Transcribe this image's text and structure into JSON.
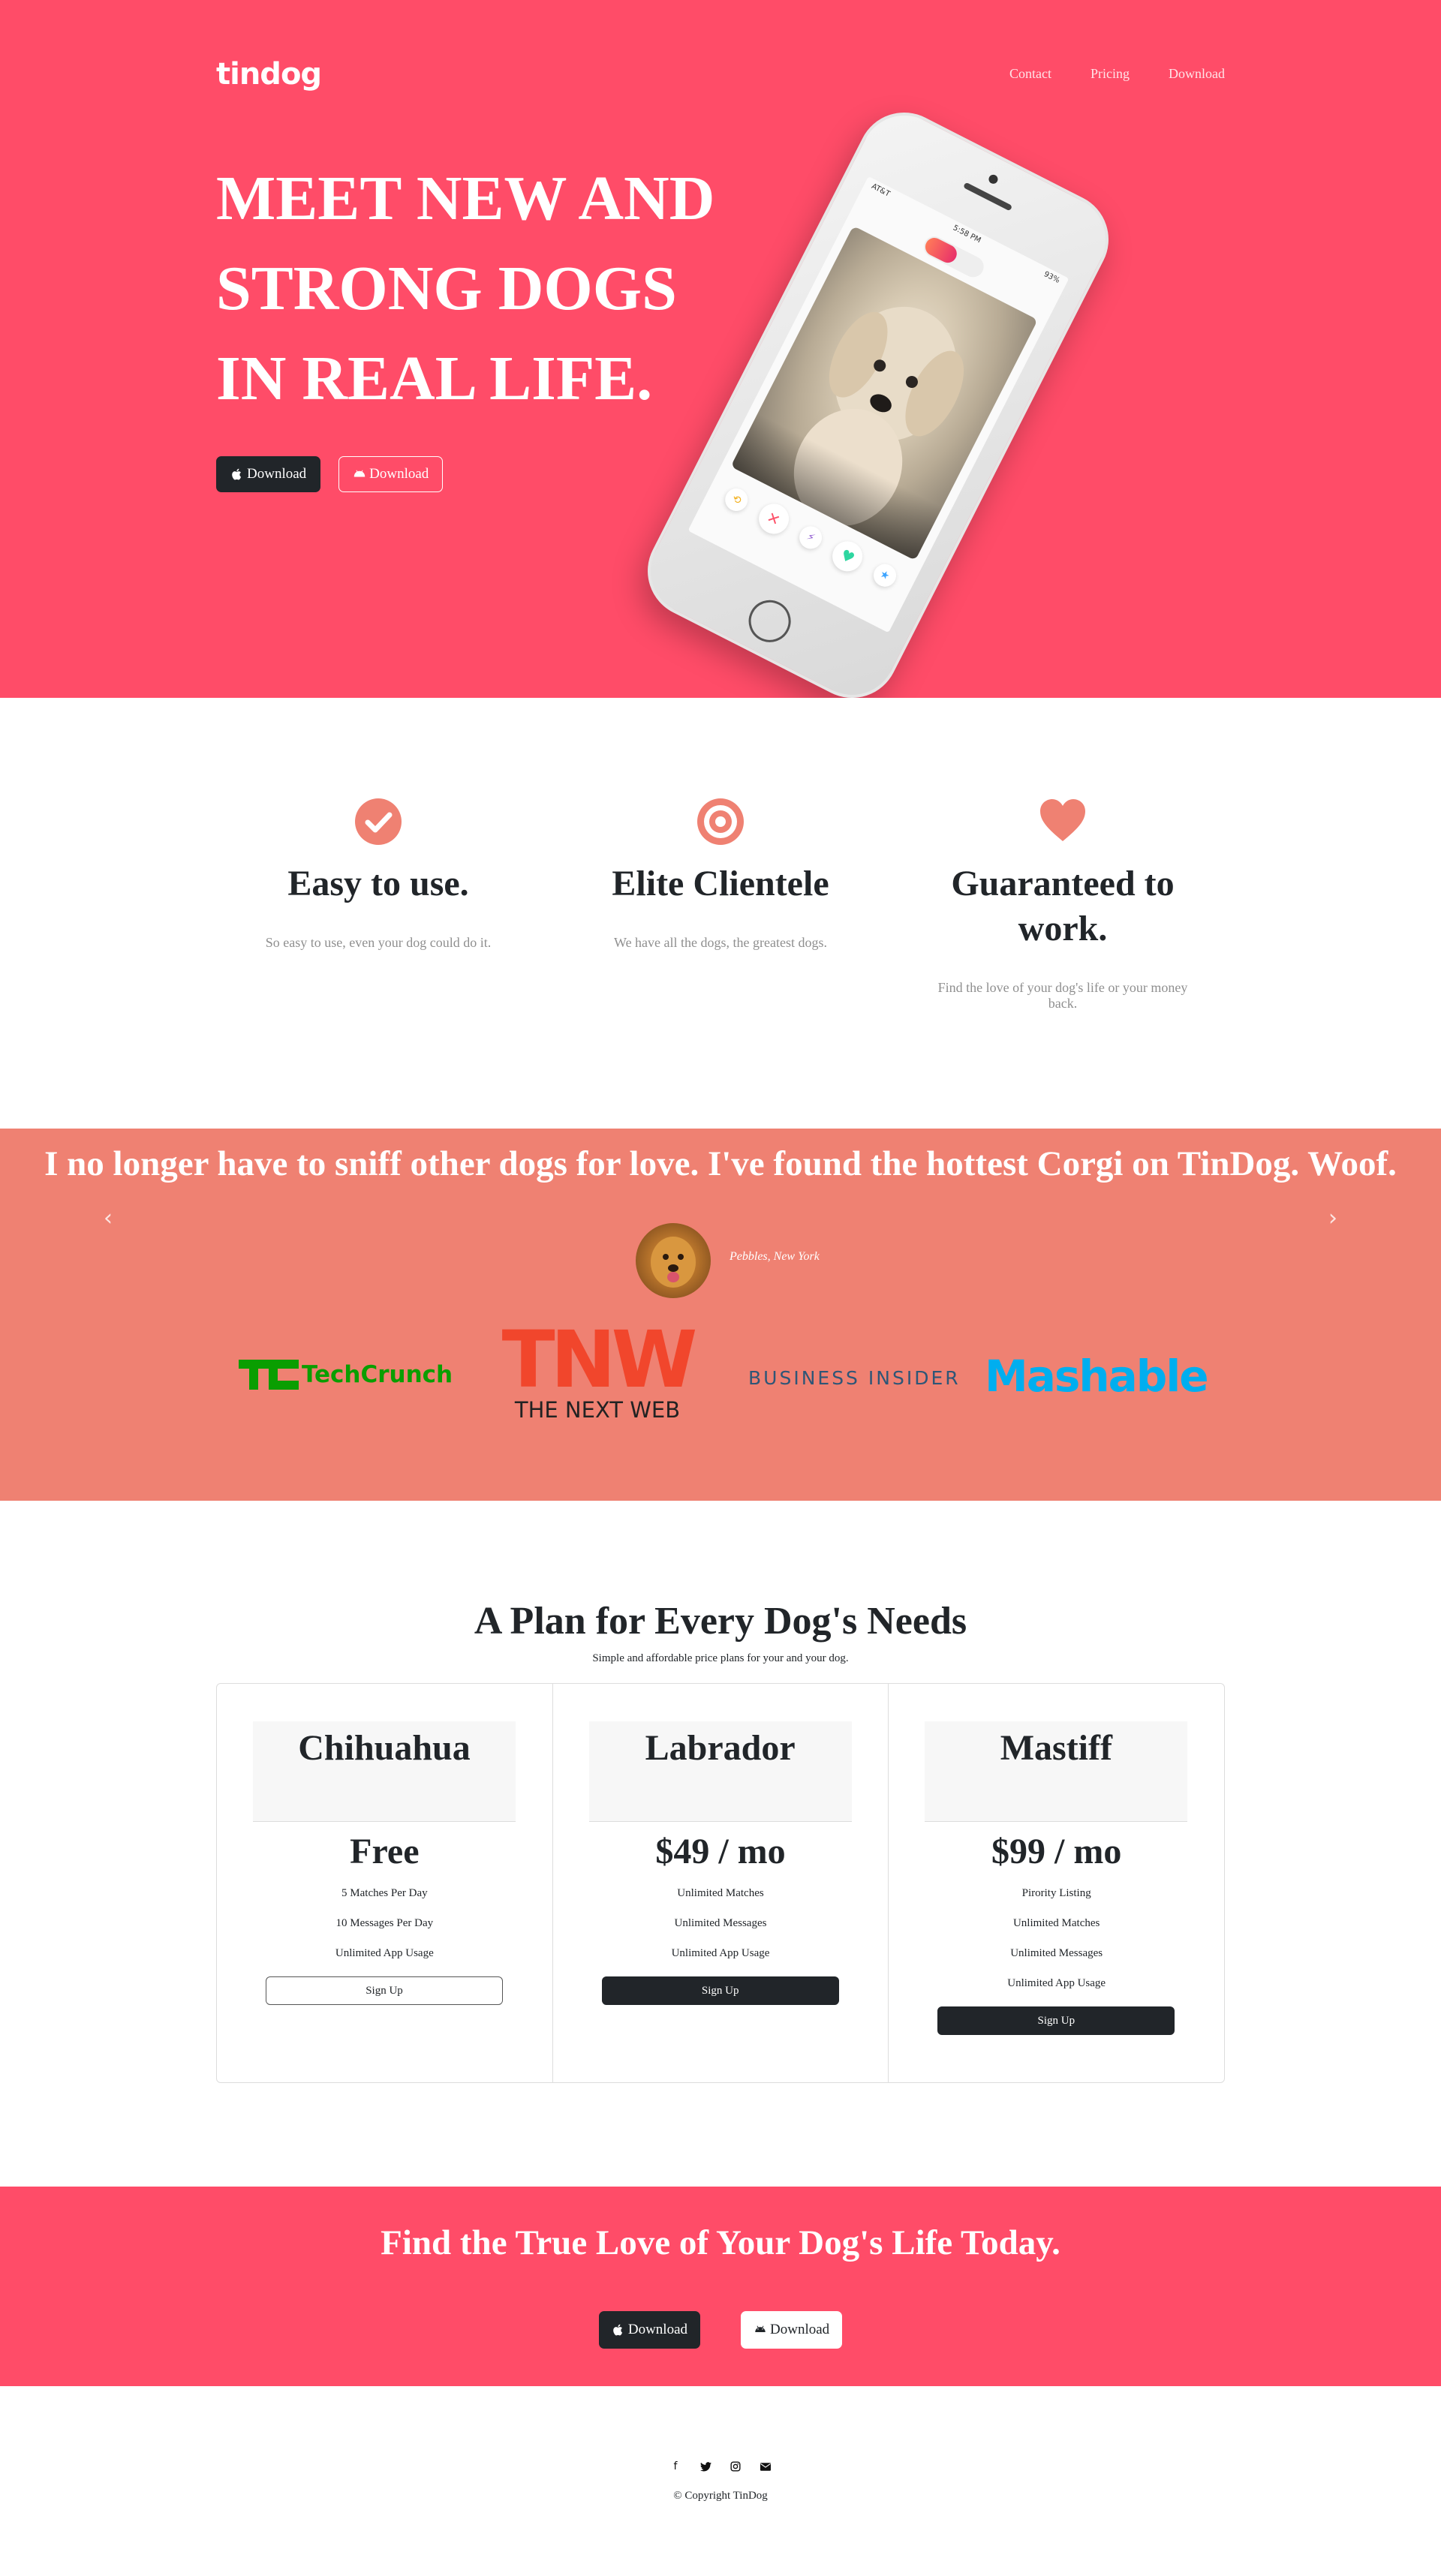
{
  "brand": "tindog",
  "nav": {
    "contact": "Contact",
    "pricing": "Pricing",
    "download": "Download"
  },
  "hero": {
    "title_lines": [
      "MEET NEW AND",
      "STRONG DOGS",
      "IN REAL LIFE."
    ],
    "apple_download": "Download",
    "android_download": "Download",
    "phone": {
      "carrier": "AT&T",
      "time": "5:58 PM",
      "battery": "93%"
    }
  },
  "features": [
    {
      "title": "Easy to use.",
      "text": "So easy to use, even your dog could do it.",
      "icon": "check-circle-icon"
    },
    {
      "title": "Elite Clientele",
      "text": "We have all the dogs, the greatest dogs.",
      "icon": "bullseye-icon"
    },
    {
      "title": "Guaranteed to work.",
      "text": "Find the love of your dog's life or your money back.",
      "icon": "heart-icon"
    }
  ],
  "testimonial": {
    "quote": "I no longer have to sniff other dogs for love. I've found the hottest Corgi on TinDog. Woof.",
    "author": "Pebbles, New York"
  },
  "press": {
    "techcrunch": "TechCrunch",
    "tnw_mark": "TNW",
    "tnw": "THE NEXT WEB",
    "business_insider": "BUSINESS INSIDER",
    "mashable": "Mashable"
  },
  "pricing": {
    "title": "A Plan for Every Dog's Needs",
    "subtitle": "Simple and affordable price plans for your and your dog.",
    "plans": [
      {
        "name": "Chihuahua",
        "price": "Free",
        "features": [
          "5 Matches Per Day",
          "10 Messages Per Day",
          "Unlimited App Usage"
        ],
        "button": "Sign Up"
      },
      {
        "name": "Labrador",
        "price": "$49 / mo",
        "features": [
          "Unlimited Matches",
          "Unlimited Messages",
          "Unlimited App Usage"
        ],
        "button": "Sign Up"
      },
      {
        "name": "Mastiff",
        "price": "$99 / mo",
        "features": [
          "Pirority Listing",
          "Unlimited Matches",
          "Unlimited Messages",
          "Unlimited App Usage"
        ],
        "button": "Sign Up"
      }
    ]
  },
  "cta": {
    "title": "Find the True Love of Your Dog's Life Today.",
    "apple_download": "Download",
    "android_download": "Download"
  },
  "footer": {
    "copyright": "© Copyright TinDog"
  },
  "colors": {
    "brand_red": "#ff4c68",
    "coral": "#ef8172",
    "dark": "#212529",
    "icon_coral": "#ef8172"
  }
}
